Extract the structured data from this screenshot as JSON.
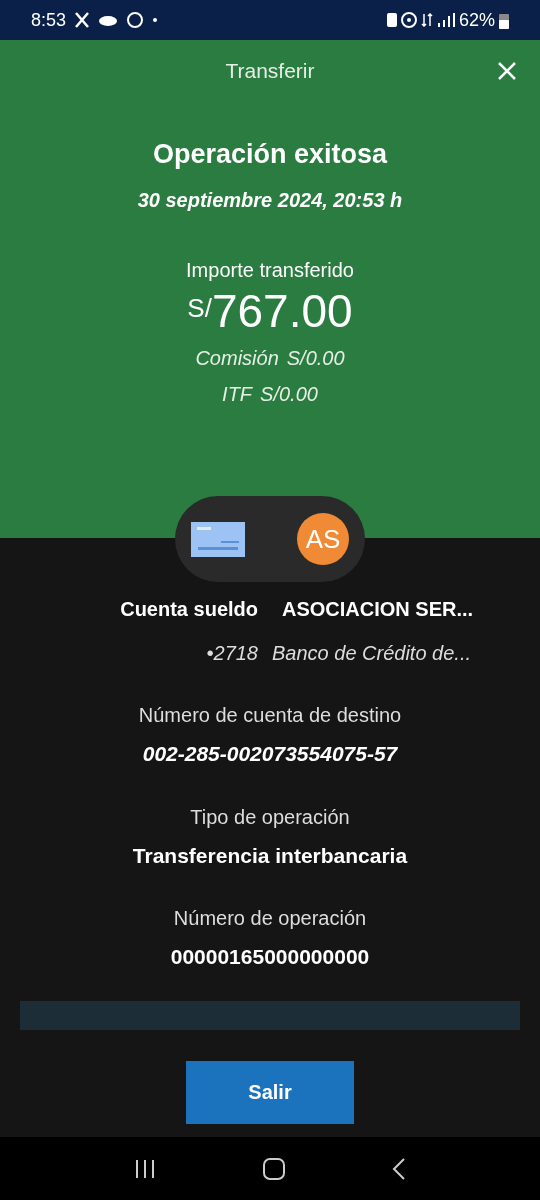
{
  "status_bar": {
    "time": "8:53",
    "battery": "62%"
  },
  "header": {
    "title": "Transferir"
  },
  "result": {
    "title": "Operación exitosa",
    "date": "30 septiembre 2024, 20:53 h",
    "amount_label": "Importe transferido",
    "currency": "S/",
    "amount": "767.00",
    "fees": [
      {
        "label": "Comisión",
        "value": "S/0.00"
      },
      {
        "label": "ITF",
        "value": "S/0.00"
      }
    ]
  },
  "parties": {
    "recipient_initials": "AS",
    "origin_name": "Cuenta sueldo",
    "origin_number": "•2718",
    "recipient_name": "ASOCIACION SER...",
    "recipient_bank": "Banco de Crédito de..."
  },
  "details": [
    {
      "label": "Número de cuenta de destino",
      "value": "002-285-002073554075-57",
      "italic": true
    },
    {
      "label": "Tipo de operación",
      "value": "Transferencia interbancaria",
      "italic": false
    },
    {
      "label": "Número de operación",
      "value": "00000165000000000",
      "italic": false
    }
  ],
  "buttons": [
    "Salir"
  ]
}
